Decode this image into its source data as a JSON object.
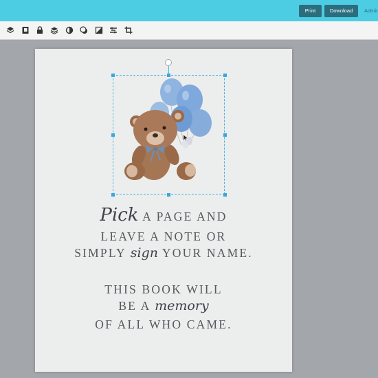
{
  "header": {
    "print_label": "Print",
    "download_label": "Download",
    "admin_label": "Admin"
  },
  "toolbar": {
    "tools": [
      "layers-icon",
      "book-icon",
      "lock-icon",
      "stack-icon",
      "flip-icon",
      "shadow-icon",
      "opacity-icon",
      "align-icon",
      "crop-icon"
    ]
  },
  "canvas": {
    "image_name": "teddy-bear-with-blue-balloons",
    "lines": [
      {
        "script": "Pick",
        "rest": " A PAGE AND"
      },
      {
        "text": "LEAVE A NOTE OR"
      },
      {
        "pre": "SIMPLY ",
        "script": "sign",
        "post": " YOUR NAME."
      },
      {
        "text": "THIS BOOK WILL"
      },
      {
        "pre": "BE A ",
        "script": "memory"
      },
      {
        "text": "OF ALL WHO CAME."
      }
    ]
  },
  "colors": {
    "topbar": "#4ccde4",
    "button": "#2a6e7e",
    "workspace": "#a3a7ab",
    "selection": "#4ab3e0"
  }
}
